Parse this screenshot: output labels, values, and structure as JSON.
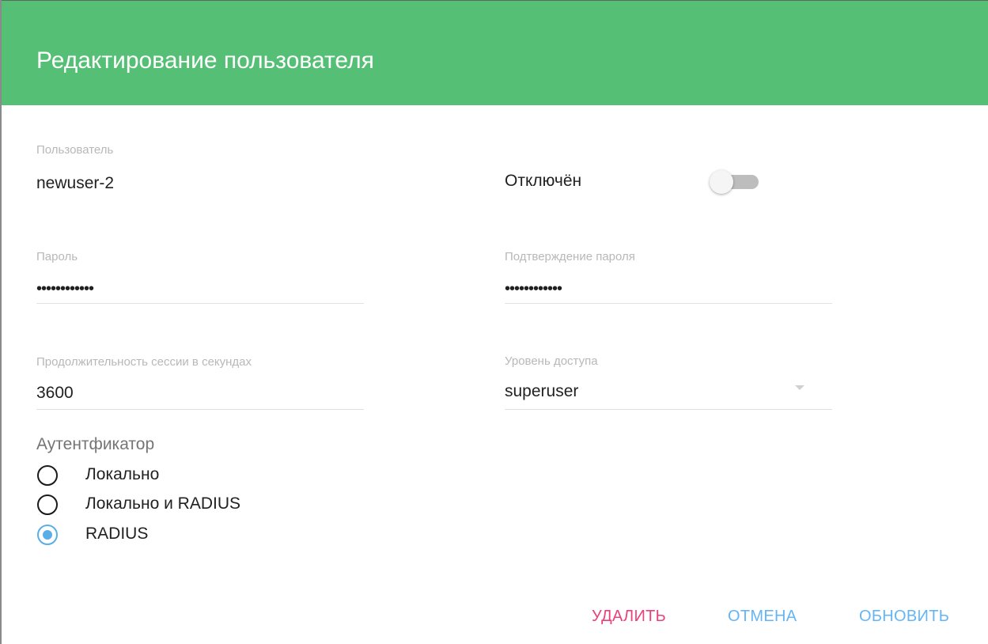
{
  "dialog": {
    "title": "Редактирование пользователя",
    "accent_color": "#55bf75"
  },
  "fields": {
    "user": {
      "label": "Пользователь",
      "value": "newuser-2"
    },
    "disabled": {
      "label": "Отключён",
      "on": false
    },
    "password": {
      "label": "Пароль",
      "value": "••••••••••••"
    },
    "password_confirm": {
      "label": "Подтверждение пароля",
      "value": "••••••••••••"
    },
    "session": {
      "label": "Продолжительность сессии в секундах",
      "value": "3600"
    },
    "access_level": {
      "label": "Уровень доступа",
      "value": "superuser",
      "icon": "chevron-down-icon"
    }
  },
  "authenticator": {
    "title": "Аутентфикатор",
    "options": [
      {
        "label": "Локально",
        "checked": false
      },
      {
        "label": "Локально и RADIUS",
        "checked": false
      },
      {
        "label": "RADIUS",
        "checked": true
      }
    ],
    "checked_color": "#5aaee8"
  },
  "actions": {
    "delete": {
      "label": "УДАЛИТЬ",
      "color": "#ec407a"
    },
    "cancel": {
      "label": "ОТМЕНА",
      "color": "#64b5f6"
    },
    "update": {
      "label": "ОБНОВИТЬ",
      "color": "#64b5f6"
    }
  }
}
